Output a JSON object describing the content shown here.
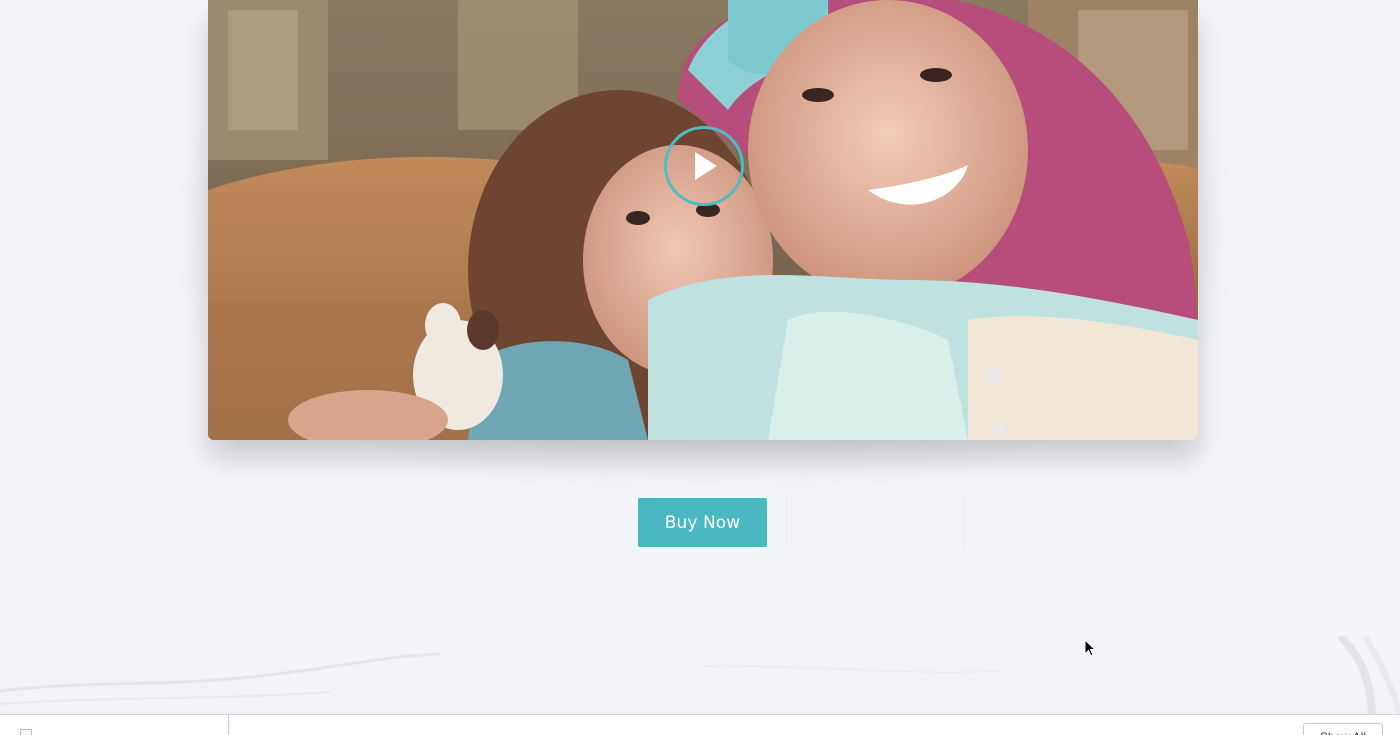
{
  "video": {
    "play_icon": "play-icon",
    "accent_color": "#4fbcc4"
  },
  "cta": {
    "buy_now_label": "Buy Now",
    "color": "#4ab8c0"
  },
  "download_bar": {
    "file_icon": "file-icon",
    "show_all_label": "Show All"
  },
  "cursor": {
    "icon": "mouse-pointer-icon"
  }
}
